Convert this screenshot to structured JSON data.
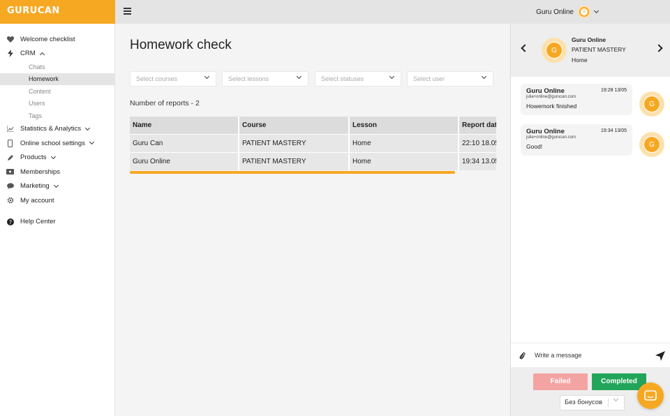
{
  "app": {
    "logo_left": "GURU",
    "logo_right": "CAN"
  },
  "topbar": {
    "user_name": "Guru Online",
    "avatar_letter": "G"
  },
  "sidebar": {
    "items": [
      {
        "label": "Welcome checklist",
        "icon": "heart-icon"
      },
      {
        "label": "CRM",
        "icon": "bolt-icon"
      },
      {
        "label": "Statistics & Analytics",
        "icon": "chart-icon"
      },
      {
        "label": "Online school settings",
        "icon": "phone-icon"
      },
      {
        "label": "Products",
        "icon": "pencil-icon"
      },
      {
        "label": "Memberships",
        "icon": "ticket-icon"
      },
      {
        "label": "Marketing",
        "icon": "chat-icon"
      },
      {
        "label": "My account",
        "icon": "gear-icon"
      },
      {
        "label": "Help Center",
        "icon": "question-icon"
      }
    ],
    "crm_sub": [
      "Chats",
      "Homework",
      "Content",
      "Users",
      "Tags"
    ]
  },
  "main": {
    "title": "Homework check",
    "filters": {
      "courses": "Select courses",
      "lessons": "Select lessons",
      "statuses": "Select statuses",
      "user": "Select user"
    },
    "reports_count": "Number of reports - 2",
    "table": {
      "headers": [
        "Name",
        "Course",
        "Lesson",
        "Report date"
      ],
      "rows": [
        [
          "Guru Can",
          "PATIENT MASTERY",
          "Home",
          "22:10 18.05"
        ],
        [
          "Guru Online",
          "PATIENT MASTERY",
          "Home",
          "19:34 13.05"
        ]
      ]
    }
  },
  "panel": {
    "header": {
      "name": "Guru Online",
      "course": "PATIENT MASTERY",
      "lesson": "Home",
      "avatar_letter": "G"
    },
    "messages": [
      {
        "name": "Guru Online",
        "time": "19:28 13/05",
        "email": "julia+online@gurucan.com",
        "text": "Howemork finished",
        "avatar_letter": "G"
      },
      {
        "name": "Guru Online",
        "time": "19:34 13/05",
        "email": "julia+online@gurucan.com",
        "text": "Good!",
        "avatar_letter": "G"
      }
    ],
    "compose_placeholder": "Write a message",
    "failed_label": "Failed",
    "completed_label": "Completed",
    "bonus_select": "Без бонусов"
  },
  "colors": {
    "brand": "#f7a823",
    "completed": "#22a55a",
    "failed": "#f4a3a3"
  }
}
